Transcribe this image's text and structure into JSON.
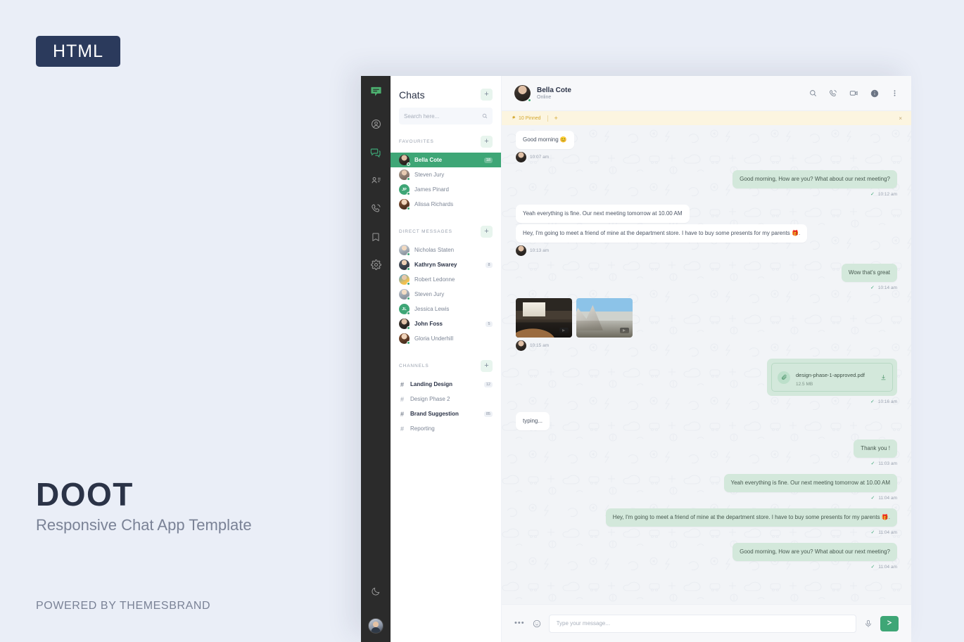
{
  "promo": {
    "badge": "HTML",
    "title": "DOOT",
    "subtitle": "Responsive Chat App Template",
    "powered_by": "POWERED BY THEMESBRAND"
  },
  "colors": {
    "accent_green": "#3ea676",
    "sent_bubble": "#d3e8db",
    "pinned_bar": "#fcf5e0",
    "pinned_text": "#d3a62b",
    "rail_dark": "#2b2b2b",
    "page_bg": "#eaeef7",
    "badge_navy": "#2b3a5c"
  },
  "rail": {
    "logo_icon": "chat-logo-icon",
    "items": [
      {
        "icon": "profile-icon",
        "name": "profile",
        "active": false
      },
      {
        "icon": "chats-icon",
        "name": "chats",
        "active": true
      },
      {
        "icon": "contacts-icon",
        "name": "contacts",
        "active": false
      },
      {
        "icon": "calls-icon",
        "name": "calls",
        "active": false
      },
      {
        "icon": "bookmark-icon",
        "name": "bookmarks",
        "active": false
      },
      {
        "icon": "settings-icon",
        "name": "settings",
        "active": false
      }
    ],
    "bottom": [
      {
        "icon": "moon-icon",
        "name": "dark-mode-toggle"
      },
      {
        "icon": "user-avatar",
        "name": "user-avatar"
      }
    ]
  },
  "chatlist": {
    "title": "Chats",
    "add_label": "+",
    "search": {
      "placeholder": "Search here...",
      "value": "",
      "icon": "search-icon"
    },
    "sections": [
      {
        "label": "FAVOURITES",
        "add_label": "+",
        "items": [
          {
            "name": "Bella Cote",
            "badge": "18",
            "active": true,
            "unread": true,
            "avatar": "photo",
            "online": true
          },
          {
            "name": "Steven Jury",
            "badge": "",
            "active": false,
            "unread": false,
            "avatar": "photo",
            "online": true
          },
          {
            "name": "James Pinard",
            "badge": "",
            "active": false,
            "unread": false,
            "avatar": "JP",
            "online": true
          },
          {
            "name": "Alissa Richards",
            "badge": "",
            "active": false,
            "unread": false,
            "avatar": "photo",
            "online": true
          }
        ]
      },
      {
        "label": "DIRECT MESSAGES",
        "add_label": "+",
        "items": [
          {
            "name": "Nicholas Staten",
            "badge": "",
            "active": false,
            "unread": false,
            "avatar": "photo",
            "online": true
          },
          {
            "name": "Kathryn Swarey",
            "badge": "8",
            "active": false,
            "unread": true,
            "avatar": "photo",
            "online": true
          },
          {
            "name": "Robert Ledonne",
            "badge": "",
            "active": false,
            "unread": false,
            "avatar": "photo",
            "online": true
          },
          {
            "name": "Steven Jury",
            "badge": "",
            "active": false,
            "unread": false,
            "avatar": "photo",
            "online": true
          },
          {
            "name": "Jessica Lewis",
            "badge": "",
            "active": false,
            "unread": false,
            "avatar": "JL",
            "online": true
          },
          {
            "name": "John Foss",
            "badge": "5",
            "active": false,
            "unread": true,
            "avatar": "photo",
            "online": true
          },
          {
            "name": "Gloria Underhill",
            "badge": "",
            "active": false,
            "unread": false,
            "avatar": "photo",
            "online": true
          }
        ]
      },
      {
        "label": "CHANNELS",
        "add_label": "+",
        "items": [
          {
            "name": "Landing Design",
            "badge": "12",
            "hash": "#",
            "unread": true
          },
          {
            "name": "Design Phase 2",
            "badge": "",
            "hash": "#",
            "unread": false
          },
          {
            "name": "Brand Suggestion",
            "badge": "85",
            "hash": "#",
            "unread": true
          },
          {
            "name": "Reporting",
            "badge": "",
            "hash": "#",
            "unread": false
          }
        ]
      }
    ]
  },
  "conversation": {
    "contact_name": "Bella Cote",
    "contact_status": "Online",
    "header_actions": [
      {
        "icon": "search-icon",
        "name": "search-conversation"
      },
      {
        "icon": "phone-call-icon",
        "name": "voice-call"
      },
      {
        "icon": "video-camera-icon",
        "name": "video-call"
      },
      {
        "icon": "info-icon",
        "name": "contact-info"
      },
      {
        "icon": "more-vertical-icon",
        "name": "more-options"
      }
    ],
    "pinned_bar": {
      "icon": "pin-icon",
      "label": "10 Pinned",
      "add_label": "+",
      "close_label": "×"
    },
    "messages": [
      {
        "side": "left",
        "type": "text",
        "text": "Good morning 😊",
        "time": "10:07 am"
      },
      {
        "side": "right",
        "type": "text",
        "text": "Good morning, How are you? What about our next meeting?",
        "time": "10:12 am"
      },
      {
        "side": "left",
        "type": "group",
        "texts": [
          "Yeah everything is fine. Our next meeting tomorrow at 10.00 AM",
          "Hey, I'm going to meet a friend of mine at the department store. I have to buy some presents for my parents 🎁."
        ],
        "time": "10:13 am"
      },
      {
        "side": "right",
        "type": "text",
        "text": "Wow that's great",
        "time": "10:14 am"
      },
      {
        "side": "left",
        "type": "images",
        "images": [
          "meeting-room-photo",
          "outdoor-rocks-photo"
        ],
        "time": "10:15 am"
      },
      {
        "side": "right",
        "type": "file",
        "file_name": "design-phase-1-approved.pdf",
        "file_size": "12.5 MB",
        "time": "10:16 am",
        "attach_icon": "paperclip-icon",
        "download_icon": "download-icon"
      },
      {
        "side": "left",
        "type": "text",
        "text": "typing...",
        "time": ""
      },
      {
        "side": "right",
        "type": "text",
        "text": "Thank you !",
        "time": "11:03 am"
      },
      {
        "side": "right",
        "type": "text",
        "text": "Yeah everything is fine. Our next meeting tomorrow at 10.00 AM",
        "time": "11:04 am"
      },
      {
        "side": "right",
        "type": "text",
        "text": "Hey, I'm going to meet a friend of mine at the department store. I have to buy some presents for my parents 🎁.",
        "time": "11:04 am"
      },
      {
        "side": "right",
        "type": "text",
        "text": "Good morning, How are you? What about our next meeting?",
        "time": "11:04 am"
      }
    ],
    "composer": {
      "more_icon": "more-horizontal-icon",
      "emoji_icon": "smiley-icon",
      "placeholder": "Type your message...",
      "value": "",
      "mic_icon": "microphone-icon",
      "send_icon": "send-icon"
    }
  }
}
